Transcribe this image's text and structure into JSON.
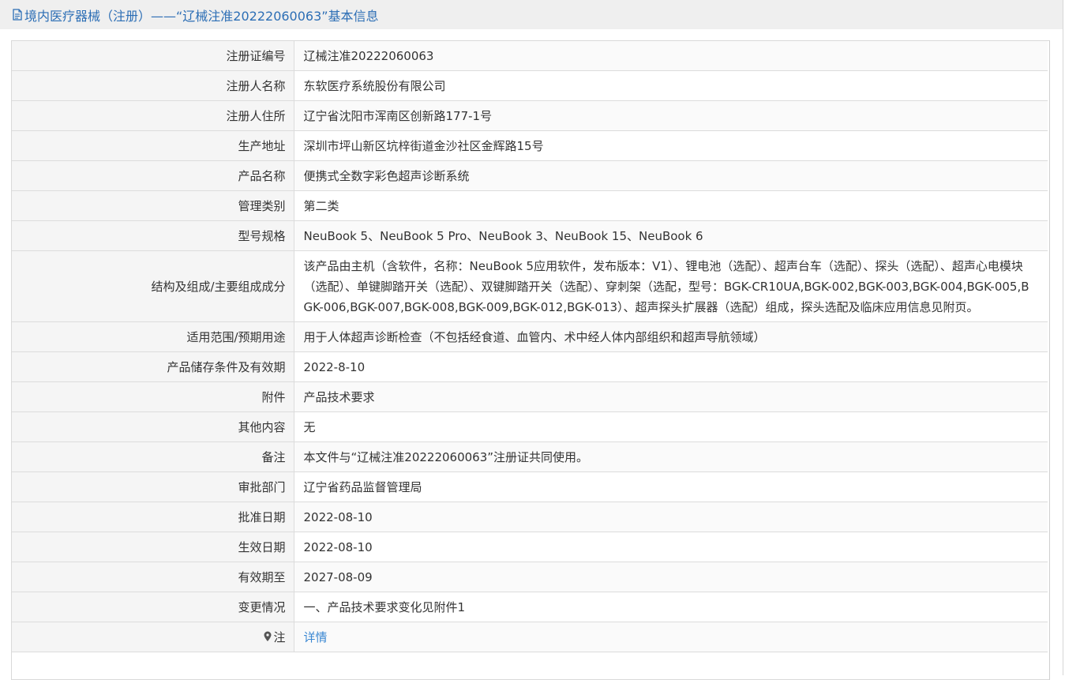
{
  "header": {
    "title": "境内医疗器械（注册）——“辽械注准20222060063”基本信息",
    "icon": "document-icon"
  },
  "rows": [
    {
      "label": "注册证编号",
      "value": "辽械注准20222060063"
    },
    {
      "label": "注册人名称",
      "value": "东软医疗系统股份有限公司"
    },
    {
      "label": "注册人住所",
      "value": "辽宁省沈阳市浑南区创新路177-1号"
    },
    {
      "label": "生产地址",
      "value": "深圳市坪山新区坑梓街道金沙社区金辉路15号"
    },
    {
      "label": "产品名称",
      "value": "便携式全数字彩色超声诊断系统"
    },
    {
      "label": "管理类别",
      "value": "第二类"
    },
    {
      "label": "型号规格",
      "value": "NeuBook 5、NeuBook 5 Pro、NeuBook 3、NeuBook 15、NeuBook 6"
    },
    {
      "label": "结构及组成/主要组成成分",
      "value": "该产品由主机（含软件，名称：NeuBook 5应用软件，发布版本：V1）、锂电池（选配）、超声台车（选配）、探头（选配）、超声心电模块（选配）、单键脚踏开关（选配）、双键脚踏开关（选配）、穿刺架（选配，型号：BGK-CR10UA,BGK-002,BGK-003,BGK-004,BGK-005,BGK-006,BGK-007,BGK-008,BGK-009,BGK-012,BGK-013）、超声探头扩展器（选配）组成，探头选配及临床应用信息见附页。"
    },
    {
      "label": "适用范围/预期用途",
      "value": "用于人体超声诊断检查（不包括经食道、血管内、术中经人体内部组织和超声导航领域）"
    },
    {
      "label": "产品储存条件及有效期",
      "value": "2022-8-10"
    },
    {
      "label": "附件",
      "value": "产品技术要求"
    },
    {
      "label": "其他内容",
      "value": "无"
    },
    {
      "label": "备注",
      "value": "本文件与“辽械注准20222060063”注册证共同使用。"
    },
    {
      "label": "审批部门",
      "value": "辽宁省药品监督管理局"
    },
    {
      "label": "批准日期",
      "value": "2022-08-10"
    },
    {
      "label": "生效日期",
      "value": "2022-08-10"
    },
    {
      "label": "有效期至",
      "value": "2027-08-09"
    },
    {
      "label": "变更情况",
      "value": "一、产品技术要求变化见附件1"
    }
  ],
  "note_row": {
    "label": "注",
    "icon": "map-pin-icon",
    "link_text": "详情"
  },
  "colors": {
    "header_bg": "#efefef",
    "title_color": "#2c6eb5",
    "label_bg": "#f5f5f5",
    "link_color": "#3a87d2",
    "border": "#dcdcdc"
  }
}
